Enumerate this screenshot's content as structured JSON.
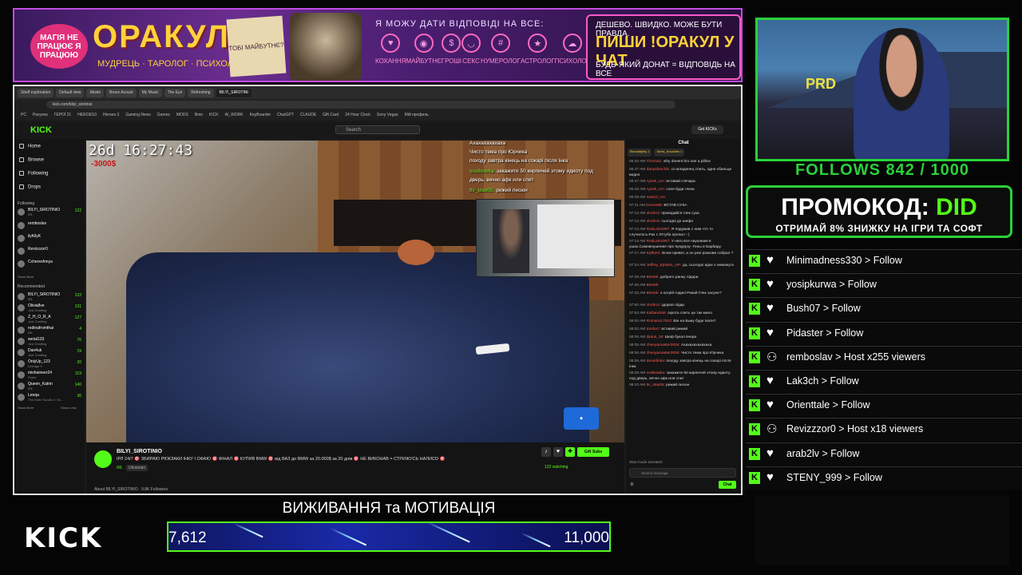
{
  "banner": {
    "left_badge": "МАГІЯ НЕ ПРАЦЮЄ Я ПРАЦЮЮ",
    "title": "ОРАКУЛ",
    "subtitle": "МУДРЕЦЬ · ТАРОЛОГ · ПСИХОЛОГ",
    "card_text": "ТОБІ МАЙБУТНЄ?",
    "question": "Я МОЖУ ДАТИ ВІДПОВІДІ НА ВСЕ:",
    "topics": [
      "КОХАННЯ",
      "МАЙБУТНЄ",
      "ГРОШІ",
      "СЕКС",
      "НУМЕРОЛОГ",
      "АСТРОЛОГ",
      "ПСИХОЛОГ"
    ],
    "right_line1": "ДЕШЕВО. ШВИДКО. МОЖЕ БУТИ ПРАВДА.",
    "right_line2": "ПИШИ !ОРАКУЛ У ЧАТ",
    "right_line3": "БУДЬ-ЯКИЙ ДОНАТ = ВІДПОВІДЬ НА ВСЕ"
  },
  "browser": {
    "tabs": [
      "Shelf exploration",
      "Default view",
      "Aksim",
      "Bruce Acoust",
      "My Music",
      "The Eye",
      "Refreshing",
      "BILYI_SIROTINI"
    ],
    "url": "kick.com/bilyi_sirotinio",
    "bookmarks": [
      "PC",
      "Рахунок",
      "ГЕРОЇ 21",
      "HEROES3",
      "Heroes 3",
      "Gaming News",
      "Games",
      "MODS",
      "Bots",
      "KICK",
      "AI_WORK",
      "KeyBoarder",
      "ChatGPT",
      "CLAUDE",
      "Gift Card",
      "24 Hour Clock",
      "Sony Vegas",
      "Мій профиль"
    ]
  },
  "kick": {
    "logo": "KICK",
    "search_placeholder": "Search",
    "get_kicks": "Get KICKs",
    "nav": [
      "Home",
      "Browse",
      "Following",
      "Drops"
    ],
    "following_label": "Following",
    "following": [
      {
        "name": "BILYI_SIROTINIO",
        "game": "IRL",
        "count": "122"
      },
      {
        "name": "remboslav",
        "game": "",
        "count": ""
      },
      {
        "name": "ilyKilyK",
        "game": "",
        "count": ""
      },
      {
        "name": "Revizzzor0",
        "game": "",
        "count": ""
      },
      {
        "name": "Ccheresfnnya",
        "game": "",
        "count": ""
      }
    ],
    "show_more": "Show More",
    "recommended_label": "Recommended",
    "recommended": [
      {
        "name": "BILYI_SIROTINIO",
        "game": "IRL",
        "count": "122"
      },
      {
        "name": "Olivia8ve",
        "game": "Just Chatting",
        "count": "131"
      },
      {
        "name": "Z_H_O_R_A",
        "game": "Just Chatting",
        "count": "127"
      },
      {
        "name": "rodinafromthai",
        "game": "IRL",
        "count": "4"
      },
      {
        "name": "serial133",
        "game": "Just Chatting",
        "count": "76"
      },
      {
        "name": "Dan4uk",
        "game": "Just Chatting",
        "count": "19"
      },
      {
        "name": "OnlyUp_123",
        "game": "Lineage II",
        "count": "20"
      },
      {
        "name": "mishaineer24",
        "game": "Poker",
        "count": "119"
      },
      {
        "name": "Queen_Katrin",
        "game": "IRL",
        "count": "140"
      },
      {
        "name": "Leeqa",
        "game": "The Elder Scrolls V: Sk...",
        "count": "36"
      }
    ],
    "show_more2": "Show More",
    "show_less": "Show Less",
    "video": {
      "timestamp": "26d 16:27:43",
      "red_text": "-3000$",
      "overlay_chat": [
        {
          "user": "",
          "text": "Ахахахахахаха"
        },
        {
          "user": "",
          "text": "Чисто тема про Юрчика"
        },
        {
          "user": "",
          "text": "походу завтра кінець на сокарі після інка"
        },
        {
          "user": "sosibowka:",
          "text": "закажите 50 кирпичей этому идиоту под"
        },
        {
          "user": "",
          "text": "дверь, вечно афк или спит"
        },
        {
          "user": "ttv_stas05:",
          "text": "рижий песюн"
        }
      ]
    },
    "stream": {
      "streamer": "BILYI_SIROTINIO",
      "title": "IРЛ 24/7 🎯 ЗБИРАЮ РЮКЗАКИ ІНКУ І ОФАЮ 🎯 ФІНАЛ 🎯 КУПИВ BMW 🎯 від ВАЗ до BMW за 20.000$ за 20 днів 🎯 НЕ ВИКОНАВ = СТРИЖУСЬ НАЛИСО 🎯",
      "category": "IRL",
      "tag": "Ukrainian",
      "gift_subs": "Gift Subs",
      "watching": "122 watching",
      "about": "About BILYI_SIROTINIO · 9.8K Followers"
    },
    "chat": {
      "header": "Chat",
      "pins": [
        "Borodatyhly 1",
        "Sonic_Knuckles 1"
      ],
      "messages": [
        {
          "time": "06:40 AM",
          "user": "Thorzain:",
          "text": "why doesnt bro use a pillow"
        },
        {
          "time": "06:47 AM",
          "user": "danyafanchik:",
          "text": "со младенец спить, одне єбальце видно"
        },
        {
          "time": "06:47 AM",
          "user": "Ayzek_UA:",
          "text": "вставай глечара"
        },
        {
          "time": "06:48 AM",
          "user": "Ayzek_UA:",
          "text": "соня буди глека"
        },
        {
          "time": "06:49 AM",
          "user": "nasi22_UA:",
          "text": ""
        },
        {
          "time": "07:11 AM",
          "user": "Drums88:",
          "text": "ВСТАВ СУКА"
        },
        {
          "time": "07:12 AM",
          "user": "ohohn3:",
          "text": "прокидайся глек сука"
        },
        {
          "time": "07:12 AM",
          "user": "ohohn3:",
          "text": "сьогодні до шефа"
        },
        {
          "time": "07:13 AM",
          "user": "RedLain1967:",
          "text": "Я подумав с ним что то случилось.Раз с Ютуба пропал :-)"
        },
        {
          "time": "07:14 AM",
          "user": "RedLain1967:",
          "text": "У него все наушники в ушах.Самовнушение про Кукурузу -Гены и Барбару."
        },
        {
          "time": "07:17 AM",
          "user": "Kptforrs:",
          "text": "Всем привет, а он уже разкови собрал ?"
        },
        {
          "time": "07:34 AM",
          "user": "Jeffrey_Epstein_vIP:",
          "text": "да, сьогодні вдає к неможуть"
        },
        {
          "time": "07:39 AM",
          "user": "B0nsik:",
          "text": "доброго ранку лідари"
        },
        {
          "time": "07:40 AM",
          "user": "B0nsik:",
          "text": ""
        },
        {
          "time": "07:42 AM",
          "user": "B0nsik:",
          "text": "о котрій годині Рикий Глек засуне?"
        },
        {
          "time": "07:50 AM",
          "user": "ohohn3:",
          "text": "здоров лідар"
        },
        {
          "time": "07:53 AM",
          "user": "Kalliandrak:",
          "text": "скрота спить це так мило"
        },
        {
          "time": "08:00 AM",
          "user": "Roman117510:",
          "text": "Він на Бьму буде їхати?"
        },
        {
          "time": "08:02 AM",
          "user": "trasha7:",
          "text": "вставай рижий"
        },
        {
          "time": "08:05 AM",
          "user": "Iliptus_16:",
          "text": "Шеф букал вчера"
        },
        {
          "time": "08:05 AM",
          "user": "zhenyamaster2004:",
          "text": "Ахахахахахахаха"
        },
        {
          "time": "08:06 AM",
          "user": "zhenyamaster2004:",
          "text": "Чисто тема про Юрчика"
        },
        {
          "time": "08:06 AM",
          "user": "denirdinka:",
          "text": "походу завтра кінець на сокарі після інка"
        },
        {
          "time": "08:08 AM",
          "user": "sosibowka:",
          "text": "закажите 50 кирпичей этому идиоту под дверь, вечно афк или спит"
        },
        {
          "time": "08:10 AM",
          "user": "ttv_stas05:",
          "text": "рижий песюн"
        }
      ],
      "slow_mode": "Slow mode activated",
      "input_placeholder": "Send a message",
      "count": "0",
      "send": "Chat"
    }
  },
  "goal": {
    "title": "ВИЖИВАННЯ та МОТИВАЦІЯ",
    "current": "7,612",
    "max": "11,000",
    "progress": 0.692
  },
  "bottom_logo": "KICK",
  "webcam_sign": "PRD",
  "follows": "FOLLOWS 842 / 1000",
  "promo": {
    "label": "ПРОМОКОД:",
    "code": "DID",
    "sub": "ОТРИМАЙ 8% ЗНИЖКУ НА ІГРИ ТА СОФТ"
  },
  "events": [
    {
      "icon": "heart",
      "text": "Minimadness330 > Follow"
    },
    {
      "icon": "heart",
      "text": "yosipkurwa > Follow"
    },
    {
      "icon": "heart",
      "text": "Bush07 > Follow"
    },
    {
      "icon": "heart",
      "text": "Pidaster > Follow"
    },
    {
      "icon": "people",
      "text": "remboslav > Host x255 viewers"
    },
    {
      "icon": "heart",
      "text": "Lak3ch > Follow"
    },
    {
      "icon": "heart",
      "text": "Orienttale > Follow"
    },
    {
      "icon": "people",
      "text": "Revizzzor0 > Host x18 viewers"
    },
    {
      "icon": "heart",
      "text": "arab2lv > Follow"
    },
    {
      "icon": "heart",
      "text": "STENY_999 > Follow"
    }
  ],
  "colors": {
    "kick_green": "#53fc18",
    "overlay_green": "#2ad13a",
    "banner_purple": "#6b2d8f",
    "banner_gold": "#ffd23a"
  }
}
